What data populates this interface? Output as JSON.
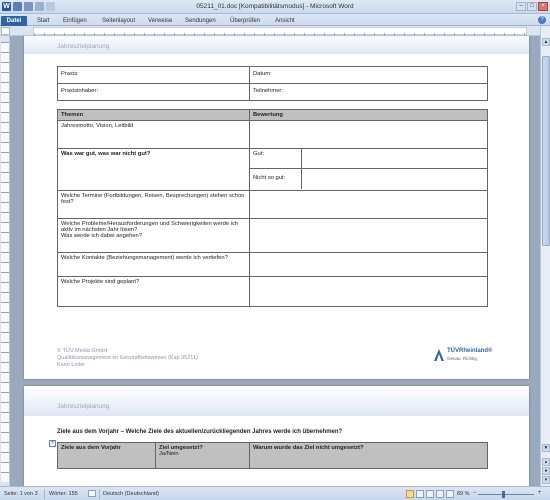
{
  "window": {
    "title": "05211_01.doc [Kompatibilitätsmodus] - Microsoft Word"
  },
  "ribbon": {
    "tabs": [
      "Datei",
      "Start",
      "Einfügen",
      "Seitenlayout",
      "Verweise",
      "Sendungen",
      "Überprüfen",
      "Ansicht"
    ]
  },
  "page1": {
    "header": "Jahreszielplanung",
    "info_table": {
      "praxis": "Praxis:",
      "datum": "Datum:",
      "praxisinhaber": "Praxisinhaber:",
      "teilnehmer": "Teilnehmer:"
    },
    "main_table": {
      "headers": [
        "Themen",
        "Bewertung"
      ],
      "rows": [
        "Jahresmotto, Vision, Leitbild",
        "Was war gut, was war nicht gut?",
        "Welche Termine (Fortbildungen, Reisen, Besprechungen) stehen schon fest?",
        "Welche Probleme/Herausforderungen und Schwierigkeiten werde ich aktiv im nächsten Jahr lösen?\nWas werde ich dabei angehen?",
        "Welche Kontakte (Beziehungsmanagement) werde ich vertiefen?",
        "Welche Projekte sind geplant?"
      ],
      "gut_label": "Gut:",
      "nicht_gut_label": "Nicht so gut:"
    },
    "footer": {
      "line1": "© TÜV Media GmbH",
      "line2": "Qualitätsmanagement im Gesundheitswesen (Kap 05211)",
      "line3": "Karin Leiter"
    },
    "logo": {
      "brand": "TÜVRheinland®",
      "tagline": "Genau. Richtig."
    }
  },
  "page2": {
    "header": "Jahreszielplanung",
    "question": "Ziele aus dem Vorjahr – Welche Ziele des aktuellen/zurückliegenden Jahres werde ich übernehmen?",
    "table_headers": {
      "col1": "Ziele aus dem Vorjahr",
      "col2_line1": "Ziel umgesetzt?",
      "col2_line2": "Ja/Nein",
      "col3": "Warum wurde das Ziel nicht umgesetzt?"
    }
  },
  "statusbar": {
    "page": "Seite: 1 von 3",
    "words": "Wörter: 155",
    "language": "Deutsch (Deutschland)",
    "zoom": "89 %"
  },
  "colors": {
    "file_tab": "#2e63a8",
    "table_header_bg": "#c0c0c0"
  }
}
